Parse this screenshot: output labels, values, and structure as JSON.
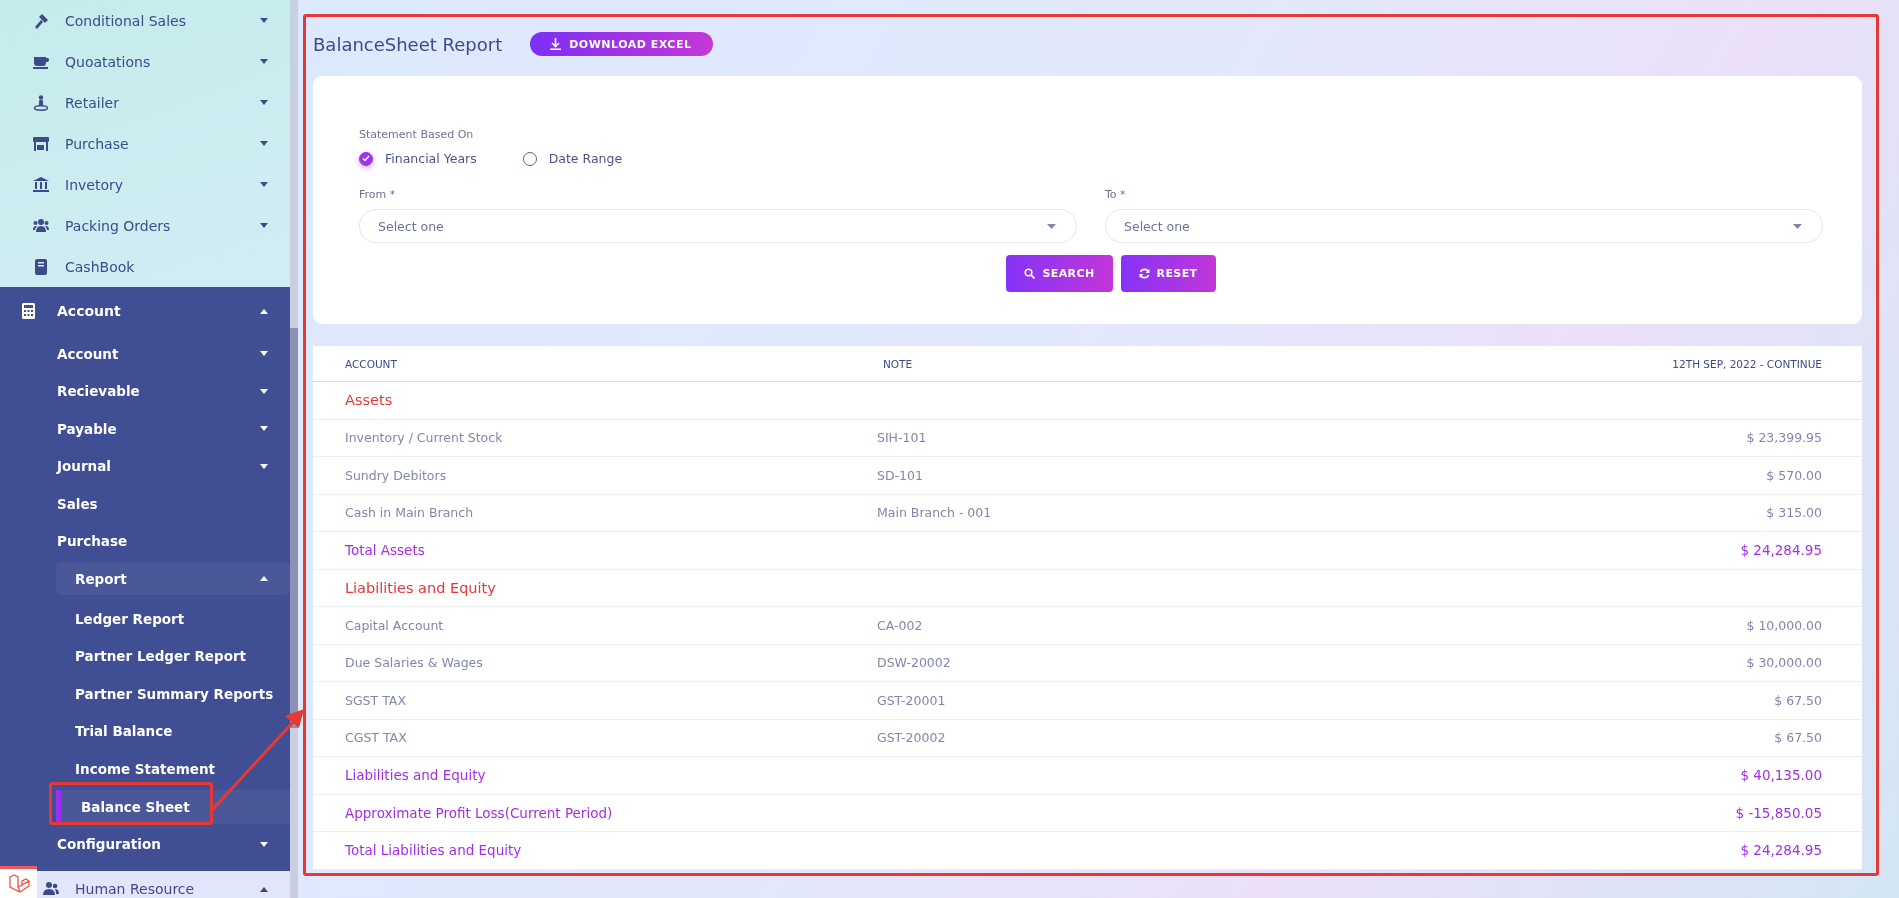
{
  "sidebar": {
    "items": [
      {
        "label": "Conditional Sales",
        "kind": "menu",
        "expanded": false
      },
      {
        "label": "Quoatations",
        "kind": "menu",
        "expanded": false
      },
      {
        "label": "Retailer",
        "kind": "menu",
        "expanded": false
      },
      {
        "label": "Purchase",
        "kind": "menu",
        "expanded": false
      },
      {
        "label": "Invetory",
        "kind": "menu",
        "expanded": false
      },
      {
        "label": "Packing Orders",
        "kind": "menu",
        "expanded": false
      },
      {
        "label": "CashBook",
        "kind": "menu"
      },
      {
        "label": "Account",
        "kind": "section",
        "expanded": true,
        "children": [
          {
            "label": "Account",
            "kind": "group",
            "expanded": false
          },
          {
            "label": "Recievable",
            "kind": "group",
            "expanded": false
          },
          {
            "label": "Payable",
            "kind": "group",
            "expanded": false
          },
          {
            "label": "Journal",
            "kind": "group",
            "expanded": false
          },
          {
            "label": "Sales",
            "kind": "group"
          },
          {
            "label": "Purchase",
            "kind": "group"
          },
          {
            "label": "Report",
            "kind": "group",
            "expanded": true,
            "children": [
              {
                "label": "Ledger Report",
                "kind": "link",
                "selected": false
              },
              {
                "label": "Partner Ledger Report",
                "kind": "link",
                "selected": false
              },
              {
                "label": "Partner Summary Reports",
                "kind": "link",
                "selected": false
              },
              {
                "label": "Trial Balance",
                "kind": "link",
                "selected": false
              },
              {
                "label": "Income Statement",
                "kind": "link",
                "selected": false
              },
              {
                "label": "Balance Sheet",
                "kind": "link",
                "selected": true
              }
            ]
          },
          {
            "label": "Configuration",
            "kind": "group",
            "expanded": false
          }
        ]
      },
      {
        "label": "Human Resource",
        "kind": "menu",
        "expanded": true
      }
    ]
  },
  "page": {
    "title": "BalanceSheet Report",
    "download_button": "DOWNLOAD EXCEL"
  },
  "filter": {
    "statement_based_on": {
      "label": "Statement Based On",
      "options": [
        {
          "label": "Financial Years",
          "selected": true
        },
        {
          "label": "Date Range",
          "selected": false
        }
      ]
    },
    "fields": [
      {
        "label": "From *",
        "placeholder": "Select one"
      },
      {
        "label": "To *",
        "placeholder": "Select one"
      }
    ],
    "buttons": [
      {
        "label": "SEARCH",
        "kind": "search"
      },
      {
        "label": "RESET",
        "kind": "reset"
      }
    ]
  },
  "table": {
    "columns": [
      "ACCOUNT",
      "NOTE",
      "12TH SEP, 2022 - CONTINUE"
    ],
    "rows": [
      {
        "kind": "heading",
        "account": "Assets"
      },
      {
        "kind": "item",
        "account": "Inventory / Current Stock",
        "note": "SIH-101",
        "amount": "$ 23,399.95"
      },
      {
        "kind": "item",
        "account": "Sundry Debitors",
        "note": "SD-101",
        "amount": "$ 570.00"
      },
      {
        "kind": "item",
        "account": "Cash in Main Branch",
        "note": "Main Branch - 001",
        "amount": "$ 315.00"
      },
      {
        "kind": "total",
        "account": "Total Assets",
        "amount": "$ 24,284.95"
      },
      {
        "kind": "heading",
        "account": "Liabilities and Equity"
      },
      {
        "kind": "item",
        "account": "Capital Account",
        "note": "CA-002",
        "amount": "$ 10,000.00"
      },
      {
        "kind": "item",
        "account": "Due Salaries & Wages",
        "note": "DSW-20002",
        "amount": "$ 30,000.00"
      },
      {
        "kind": "item",
        "account": "SGST TAX",
        "note": "GST-20001",
        "amount": "$ 67.50"
      },
      {
        "kind": "item",
        "account": "CGST TAX",
        "note": "GST-20002",
        "amount": "$ 67.50"
      },
      {
        "kind": "total",
        "account": "Liabilities and Equity",
        "amount": "$ 40,135.00"
      },
      {
        "kind": "total",
        "account": "Approximate Profit Loss(Current Period)",
        "amount": "$ -15,850.05"
      },
      {
        "kind": "total",
        "account": "Total Liabilities and Equity",
        "amount": "$ 24,284.95"
      }
    ]
  }
}
